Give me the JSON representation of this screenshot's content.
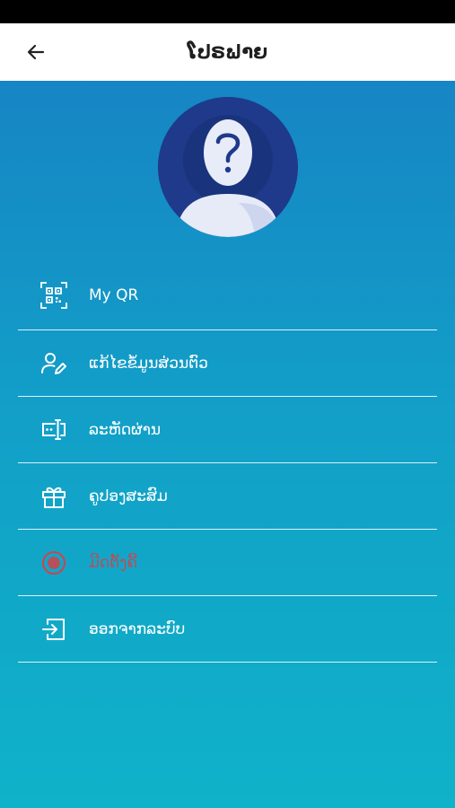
{
  "header": {
    "title": "ໂປຣຟາຍ",
    "back_icon": "arrow-left-icon"
  },
  "profile": {
    "avatar_icon": "unknown-user-avatar"
  },
  "menu": {
    "items": [
      {
        "label": "My QR",
        "icon": "qr-code-icon"
      },
      {
        "label": "ແກ້ໄຂຂໍ້ມູນສ່ວນຕົວ",
        "icon": "edit-user-icon"
      },
      {
        "label": "ລະຫັດຜ່ານ",
        "icon": "password-icon"
      },
      {
        "label": "ຄູປອງສະສົມ",
        "icon": "gift-icon"
      },
      {
        "label": "ມີດຕັ້ງຄີ້",
        "icon": "record-icon",
        "dimmed": true
      },
      {
        "label": "ອອກຈາກລະບົບ",
        "icon": "logout-icon"
      }
    ]
  },
  "colors": {
    "header_bg": "#ffffff",
    "gradient_top": "#1685c4",
    "gradient_bottom": "#0fb2c9",
    "avatar_bg": "#1f3a8a",
    "dim_item": "#d0434a"
  }
}
